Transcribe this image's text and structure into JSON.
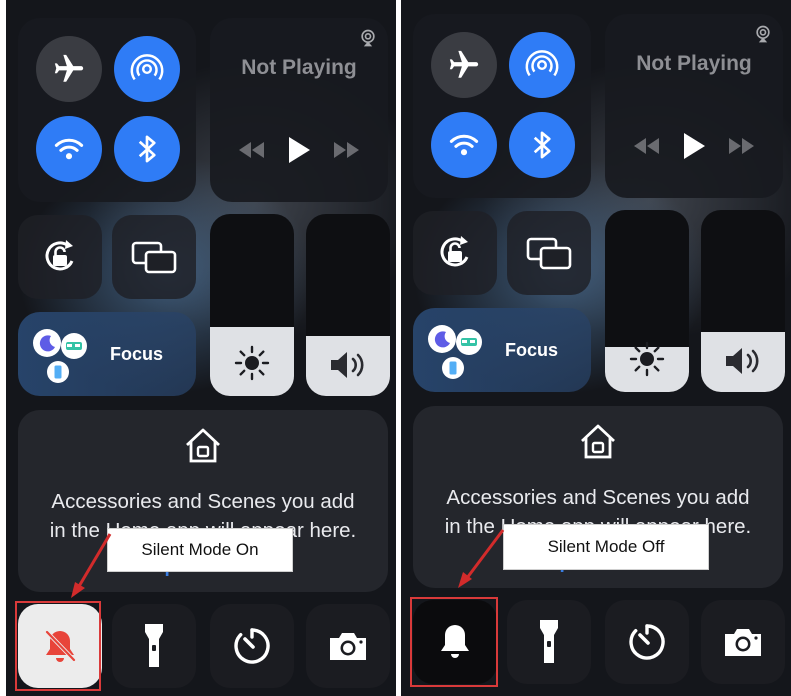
{
  "panels": [
    {
      "now_playing": {
        "title": "Not Playing"
      },
      "focus": {
        "label": "Focus"
      },
      "home": {
        "message_line1": "Accessories and Scenes you add",
        "message_line2": "in the Home app will appear here.",
        "link": "Open Home"
      },
      "brightness_level": 0.38,
      "volume_level": 0.33,
      "silent_mode": "on",
      "callout": "Silent Mode On"
    },
    {
      "now_playing": {
        "title": "Not Playing"
      },
      "focus": {
        "label": "Focus"
      },
      "home": {
        "message_line1": "Accessories and Scenes you add",
        "message_line2": "in the Home app will appear here.",
        "link": "Open Home"
      },
      "brightness_level": 0.25,
      "volume_level": 0.33,
      "silent_mode": "off",
      "callout": "Silent Mode Off"
    }
  ],
  "colors": {
    "accent_blue": "#2f7cf6",
    "silent_active_red": "#e8443a",
    "annotation_red": "#d93a3a"
  },
  "icons": [
    "airplane-icon",
    "airdrop-icon",
    "wifi-icon",
    "bluetooth-icon",
    "airplay-icon",
    "rewind-icon",
    "play-icon",
    "fast-forward-icon",
    "orientation-lock-icon",
    "screen-mirroring-icon",
    "moon-icon",
    "bed-icon",
    "phone-icon",
    "sun-icon",
    "speaker-icon",
    "home-icon",
    "bell-slash-icon",
    "bell-icon",
    "flashlight-icon",
    "timer-icon",
    "camera-icon"
  ]
}
